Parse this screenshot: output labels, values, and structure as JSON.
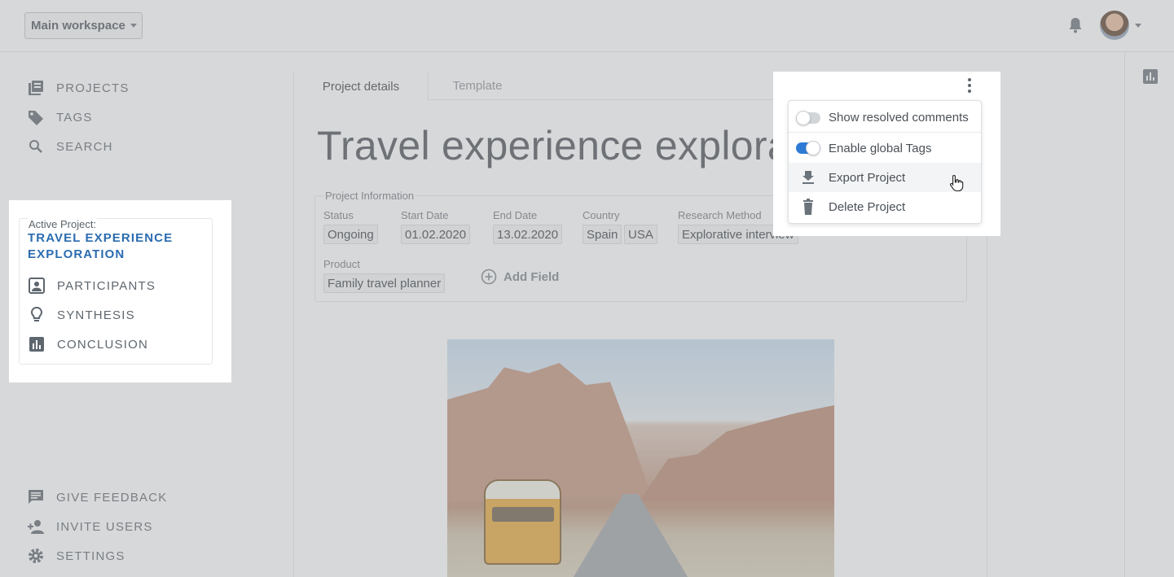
{
  "topbar": {
    "workspace_label": "Main workspace",
    "icons": [
      "bell-icon",
      "avatar",
      "chevron-down-icon"
    ]
  },
  "sidebar": {
    "nav": [
      {
        "label": "PROJECTS",
        "icon": "library-icon"
      },
      {
        "label": "TAGS",
        "icon": "tag-icon"
      },
      {
        "label": "SEARCH",
        "icon": "search-icon"
      }
    ],
    "active_project": {
      "label": "Active Project:",
      "title": "TRAVEL EXPERIENCE EXPLORATION",
      "items": [
        {
          "label": "PARTICIPANTS",
          "icon": "contact-card-icon"
        },
        {
          "label": "SYNTHESIS",
          "icon": "lightbulb-icon"
        },
        {
          "label": "CONCLUSION",
          "icon": "bar-chart-icon"
        }
      ]
    },
    "footer": [
      {
        "label": "GIVE FEEDBACK",
        "icon": "feedback-icon"
      },
      {
        "label": "INVITE USERS",
        "icon": "add-user-icon"
      },
      {
        "label": "SETTINGS",
        "icon": "gear-icon"
      }
    ]
  },
  "main": {
    "tabs": [
      {
        "label": "Project details",
        "active": true
      },
      {
        "label": "Template",
        "active": false
      }
    ],
    "title": "Travel experience exploratio",
    "project_information": {
      "legend": "Project Information",
      "fields": [
        {
          "label": "Status",
          "values": [
            "Ongoing"
          ]
        },
        {
          "label": "Start Date",
          "values": [
            "01.02.2020"
          ]
        },
        {
          "label": "End Date",
          "values": [
            "13.02.2020"
          ]
        },
        {
          "label": "Country",
          "values": [
            "Spain",
            "USA"
          ]
        },
        {
          "label": "Research Method",
          "values": [
            "Explorative interview"
          ]
        },
        {
          "label": "Product",
          "values": [
            "Family travel planner"
          ]
        }
      ],
      "add_field_label": "Add Field"
    }
  },
  "menu": {
    "items": [
      {
        "label": "Show resolved comments",
        "type": "toggle",
        "on": false
      },
      {
        "label": "Enable global Tags",
        "type": "toggle",
        "on": true
      },
      {
        "label": "Export Project",
        "type": "action",
        "icon": "download-icon",
        "hovered": true
      },
      {
        "label": "Delete Project",
        "type": "action",
        "icon": "trash-icon"
      }
    ]
  },
  "colors": {
    "accent": "#2b6cb0",
    "toggle_on": "#2e7bd6",
    "overlay": "rgba(160,162,165,0.42)"
  }
}
